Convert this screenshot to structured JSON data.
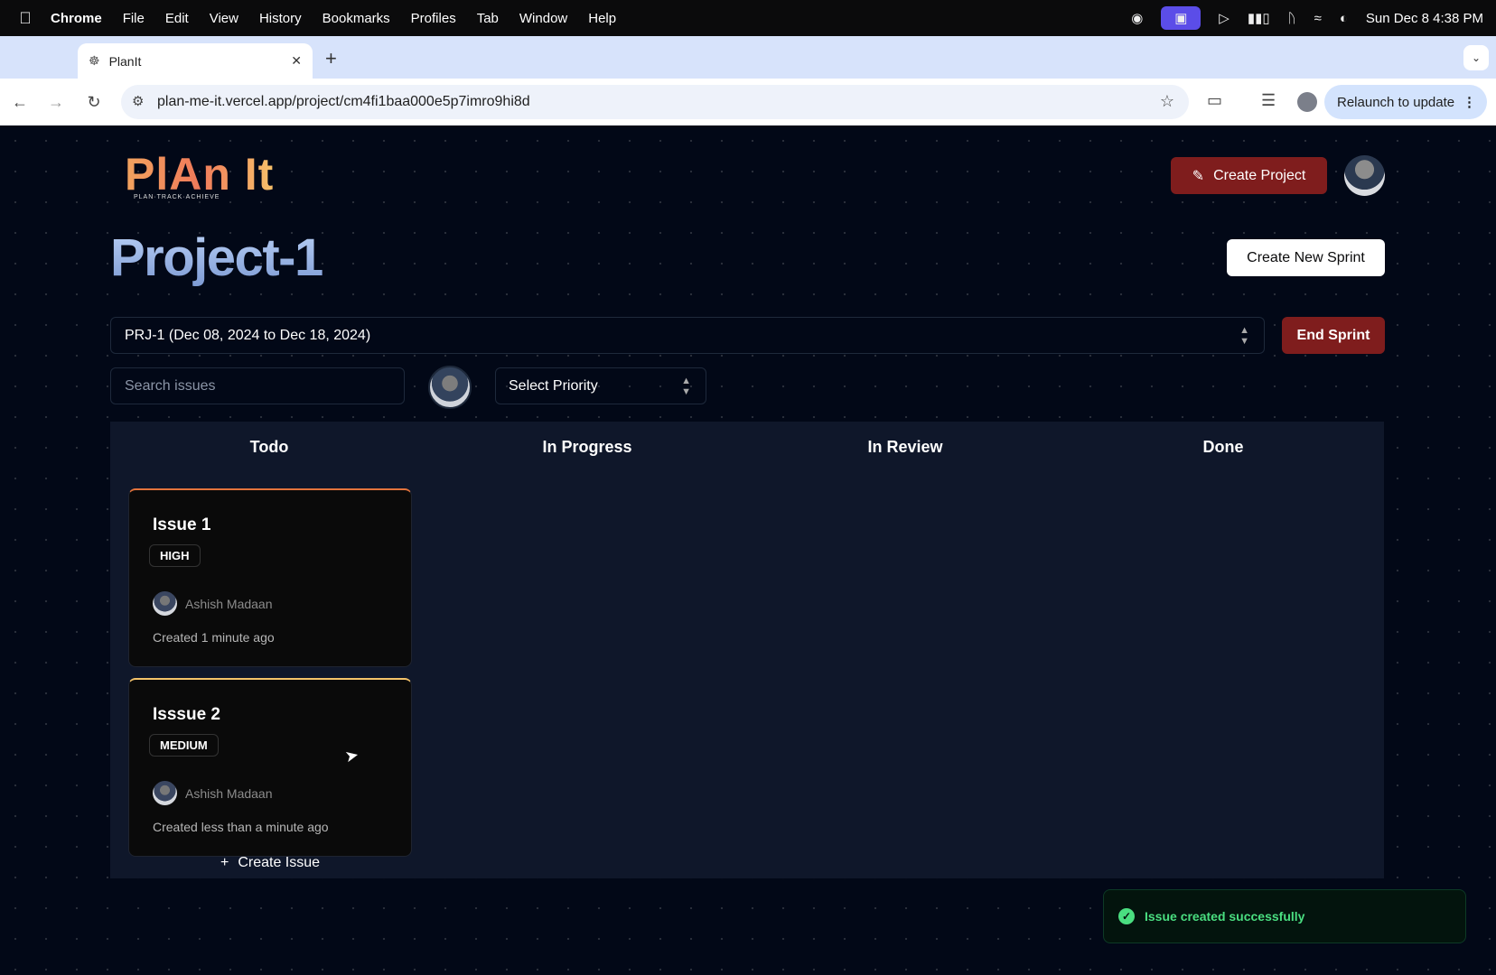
{
  "menubar": {
    "apple": "",
    "items": [
      "Chrome",
      "File",
      "Edit",
      "View",
      "History",
      "Bookmarks",
      "Profiles",
      "Tab",
      "Window",
      "Help"
    ],
    "clock": "Sun Dec 8  4:38 PM"
  },
  "browser": {
    "tab_title": "PlanIt",
    "url": "plan-me-it.vercel.app/project/cm4fi1baa000e5p7imro9hi8d",
    "relaunch_label": "Relaunch to update"
  },
  "header": {
    "logo_text": "PlAn It",
    "logo_tagline": "PLAN·TRACK·ACHIEVE",
    "create_project_label": "Create Project"
  },
  "project": {
    "title": "Project-1",
    "new_sprint_label": "Create New Sprint",
    "sprint_value": "PRJ-1 (Dec 08, 2024 to Dec 18, 2024)",
    "end_sprint_label": "End Sprint"
  },
  "filters": {
    "search_placeholder": "Search issues",
    "priority_placeholder": "Select Priority"
  },
  "board": {
    "columns": [
      "Todo",
      "In Progress",
      "In Review",
      "Done"
    ],
    "issues": [
      {
        "title": "Issue 1",
        "priority": "HIGH",
        "assignee": "Ashish Madaan",
        "created": "Created 1 minute ago"
      },
      {
        "title": "Isssue 2",
        "priority": "MEDIUM",
        "assignee": "Ashish Madaan",
        "created": "Created less than a minute ago"
      }
    ],
    "create_issue_label": "Create Issue"
  },
  "toast": {
    "message": "Issue created successfully"
  },
  "colors": {
    "accent_red": "#7f1d1d",
    "high_border": "#e2733c",
    "medium_border": "#f4c36a",
    "success": "#4ade80"
  }
}
